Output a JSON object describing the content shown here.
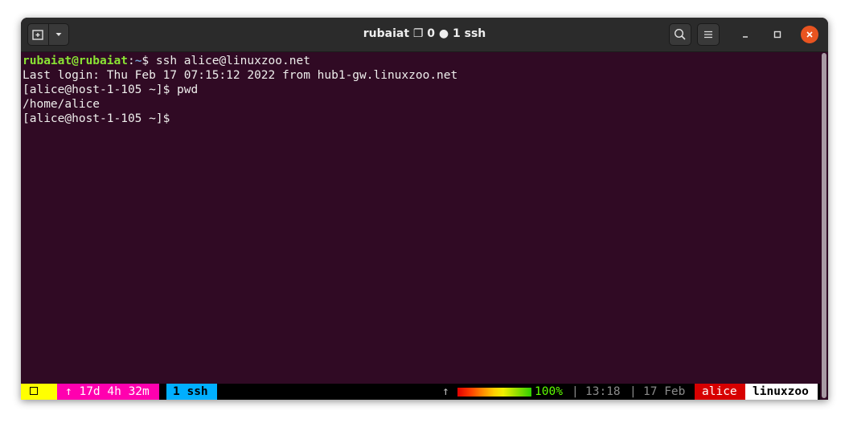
{
  "window": {
    "title": "rubaiat ❐ 0 ● 1 ssh"
  },
  "terminal": {
    "lines": [
      {
        "user": "rubaiat@rubaiat",
        "sep": ":",
        "path": "~",
        "rest": "$ ssh alice@linuxzoo.net"
      },
      {
        "text": "Last login: Thu Feb 17 07:15:12 2022 from hub1-gw.linuxzoo.net"
      },
      {
        "text": "[alice@host-1-105 ~]$ pwd"
      },
      {
        "text": "/home/alice"
      },
      {
        "text": "[alice@host-1-105 ~]$"
      }
    ]
  },
  "status_bar": {
    "session": "0",
    "uptime": "↑ 17d 4h 32m",
    "window": "1 ssh",
    "load_arrow": "↑",
    "battery": "100%",
    "separator1": "|",
    "time": "13:18",
    "separator2": "|",
    "date": "17 Feb",
    "user": "alice",
    "host": "linuxzoo"
  },
  "colors": {
    "terminal_bg": "#300a24",
    "prompt_user": "#8ae234",
    "prompt_path": "#729fcf",
    "session_bg": "#ffff00",
    "uptime_bg": "#ff00af",
    "window_bg": "#00afff",
    "user_bg": "#d70000",
    "host_bg": "#ffffff",
    "close_button": "#e95420"
  }
}
